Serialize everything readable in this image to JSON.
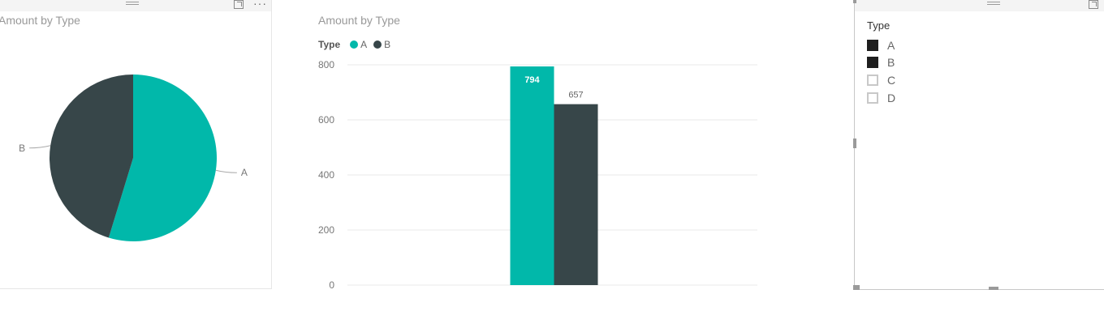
{
  "pie_visual": {
    "title": "Amount by Type",
    "more_label": "···",
    "colors": {
      "A": "#01B8AA",
      "B": "#374649"
    },
    "chart_data": {
      "type": "pie",
      "title": "Amount by Type",
      "labels": [
        "A",
        "B"
      ],
      "values": [
        794,
        657
      ]
    }
  },
  "bar_visual": {
    "title": "Amount by Type",
    "legend": {
      "title": "Type",
      "items": [
        {
          "label": "A",
          "color": "#01B8AA"
        },
        {
          "label": "B",
          "color": "#374649"
        }
      ]
    },
    "chart_data": {
      "type": "bar",
      "title": "Amount by Type",
      "categories": [
        ""
      ],
      "series": [
        {
          "name": "A",
          "values": [
            794
          ],
          "color": "#01B8AA",
          "data_label": "794"
        },
        {
          "name": "B",
          "values": [
            657
          ],
          "color": "#374649",
          "data_label": "657"
        }
      ],
      "ylim": [
        0,
        800
      ],
      "yticks": [
        "0",
        "200",
        "400",
        "600",
        "800"
      ],
      "grid": true,
      "legend_position": "top-left"
    }
  },
  "slicer": {
    "title": "Type",
    "items": [
      {
        "label": "A",
        "checked": true
      },
      {
        "label": "B",
        "checked": true
      },
      {
        "label": "C",
        "checked": false
      },
      {
        "label": "D",
        "checked": false
      }
    ]
  }
}
